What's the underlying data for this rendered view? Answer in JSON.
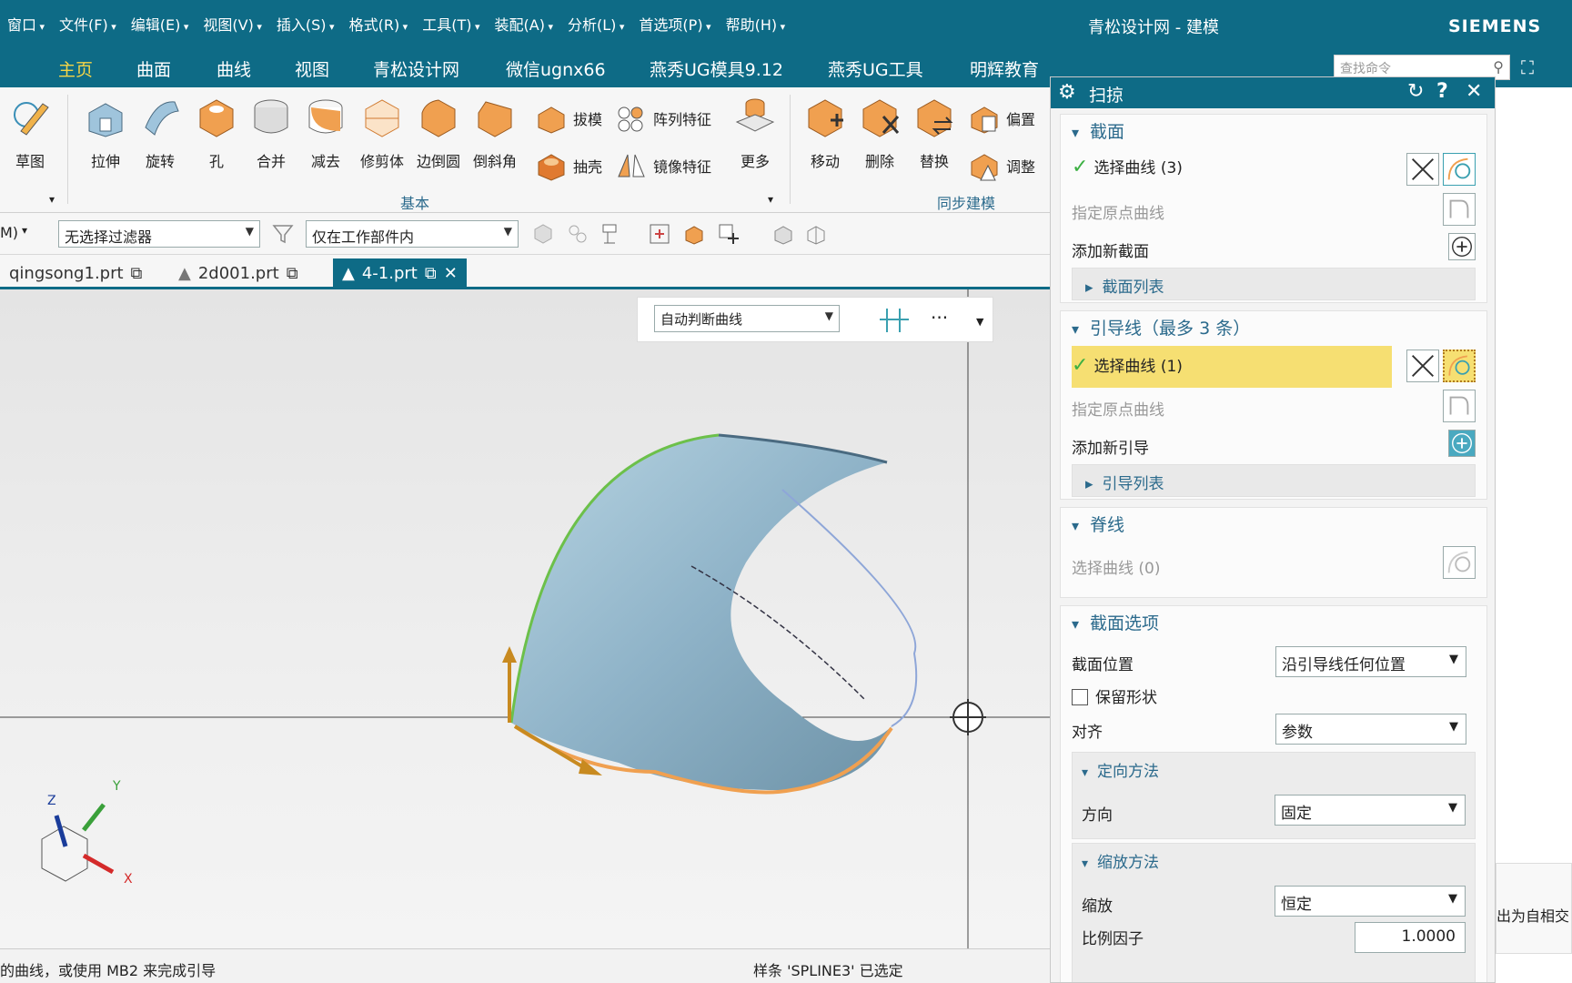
{
  "titlebar": {
    "menu": [
      "窗口",
      "文件(F)",
      "编辑(E)",
      "视图(V)",
      "插入(S)",
      "格式(R)",
      "工具(T)",
      "装配(A)",
      "分析(L)",
      "首选项(P)",
      "帮助(H)"
    ],
    "title": "青松设计网 - 建模",
    "brand": "SIEMENS"
  },
  "ribbon_tabs": {
    "items": [
      "主页",
      "曲面",
      "曲线",
      "视图",
      "青松设计网",
      "微信ugnx66",
      "燕秀UG模具9.12",
      "燕秀UG工具",
      "明辉教育"
    ],
    "active": "主页",
    "search_placeholder": "查找命令"
  },
  "ribbon": {
    "sketch": "草图",
    "basic": [
      "拉伸",
      "旋转",
      "孔",
      "合并",
      "减去",
      "修剪体",
      "边倒圆",
      "倒斜角"
    ],
    "small_top": "拔模",
    "small_bottom": "抽壳",
    "pattern": "阵列特征",
    "mirror": "镜像特征",
    "more": "更多",
    "sync": [
      "移动",
      "删除",
      "替换"
    ],
    "sync_small_top": "偏置",
    "sync_small_bottom": "调整",
    "group_basic": "基本",
    "group_sync": "同步建模"
  },
  "filterbar": {
    "mode": "M)",
    "filter": "无选择过滤器",
    "scope": "仅在工作部件内"
  },
  "doctabs": [
    "qingsong1.prt",
    "2d001.prt",
    "4-1.prt"
  ],
  "snapbar": {
    "curve_rule": "自动判断曲线",
    "more": "···"
  },
  "status": {
    "left": "的曲线，或使用 MB2 来完成引导",
    "right": "样条 'SPLINE3' 已选定"
  },
  "dialog": {
    "title": "扫掠",
    "section": {
      "header": "截面",
      "select_curve": "选择曲线 (3)",
      "origin_curve": "指定原点曲线",
      "add_new": "添加新截面",
      "list": "截面列表"
    },
    "guides": {
      "header": "引导线（最多 3 条）",
      "select_curve": "选择曲线 (1)",
      "origin_curve": "指定原点曲线",
      "add_new": "添加新引导",
      "list": "引导列表"
    },
    "spine": {
      "header": "脊线",
      "select_curve": "选择曲线 (0)"
    },
    "section_options": {
      "header": "截面选项",
      "position_label": "截面位置",
      "position_value": "沿引导线任何位置",
      "preserve_shape": "保留形状",
      "align_label": "对齐",
      "align_value": "参数",
      "orientation_header": "定向方法",
      "direction_label": "方向",
      "direction_value": "固定",
      "scaling_header": "缩放方法",
      "scale_label": "缩放",
      "scale_value": "恒定",
      "factor_label": "比例因子",
      "factor_value": "1.0000"
    }
  },
  "right_tip": "出为自相交",
  "axes": {
    "x": "X",
    "y": "Y",
    "z": "Z"
  }
}
